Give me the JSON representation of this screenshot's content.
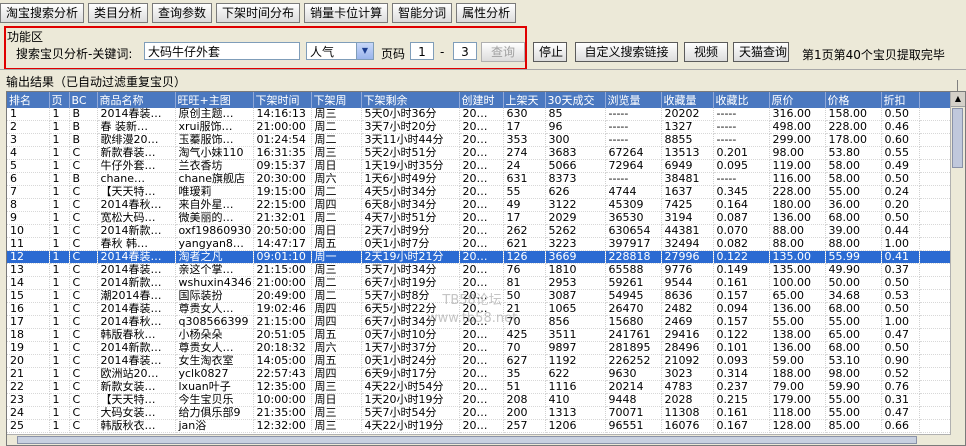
{
  "tabs": [
    "淘宝搜索分析",
    "类目分析",
    "查询参数",
    "下架时间分布",
    "销量卡位计算",
    "智能分词",
    "属性分析"
  ],
  "func_label": "功能区",
  "search": {
    "label": "搜索宝贝分析-关键词:",
    "keyword": "大码牛仔外套",
    "sort_option": "人气",
    "page_label": "页码",
    "page_from": "1",
    "page_dash": "-",
    "page_to": "3",
    "query_button": "查询"
  },
  "buttons": {
    "stop": "停止",
    "custom_link": "自定义搜索链接",
    "video": "视频",
    "tmall_query": "天猫查询"
  },
  "status_text": "第1页第40个宝贝提取完毕",
  "output_label": "输出结果（已自动过滤重复宝贝）",
  "watermark": {
    "line1": "TB58论坛",
    "line2": "www.tb58.net"
  },
  "table": {
    "columns": [
      "排名",
      "页",
      "BC",
      "商品名称",
      "旺旺+主图",
      "下架时间",
      "下架周",
      "下架剩余",
      "创建时",
      "上架天",
      "30天成交",
      "浏览量",
      "收藏量",
      "收藏比",
      "原价",
      "价格",
      "折扣",
      ""
    ],
    "rows": [
      [
        "1",
        "1",
        "B",
        "2014春装…",
        "原创主题…",
        "14:16:13",
        "周三",
        "5天0小时36分",
        "20…",
        "630",
        "85",
        "-----",
        "20202",
        "-----",
        "316.00",
        "158.00",
        "0.50",
        ""
      ],
      [
        "2",
        "1",
        "B",
        "春 装新…",
        "xrui服饰…",
        "21:00:00",
        "周二",
        "3天7小时20分",
        "20…",
        "17",
        "96",
        "-----",
        "1327",
        "-----",
        "498.00",
        "228.00",
        "0.46",
        ""
      ],
      [
        "3",
        "1",
        "B",
        "歌绯漫20…",
        "玉蓁服饰…",
        "01:24:54",
        "周二",
        "3天11小时44分",
        "20…",
        "353",
        "300",
        "-----",
        "8855",
        "-----",
        "299.00",
        "178.00",
        "0.60",
        ""
      ],
      [
        "4",
        "1",
        "C",
        "新款春装…",
        "淘气小妹110",
        "16:31:35",
        "周三",
        "5天2小时51分",
        "20…",
        "274",
        "3683",
        "67264",
        "13513",
        "0.201",
        "98.00",
        "53.80",
        "0.55",
        ""
      ],
      [
        "5",
        "1",
        "C",
        "牛仔外套…",
        "兰衣香坊",
        "09:15:37",
        "周日",
        "1天19小时35分",
        "20…",
        "24",
        "5066",
        "72964",
        "6949",
        "0.095",
        "119.00",
        "58.00",
        "0.49",
        ""
      ],
      [
        "6",
        "1",
        "B",
        "chane…",
        "chane旗舰店",
        "20:30:00",
        "周六",
        "1天6小时49分",
        "20…",
        "631",
        "8373",
        "-----",
        "38481",
        "-----",
        "116.00",
        "58.00",
        "0.50",
        ""
      ],
      [
        "7",
        "1",
        "C",
        "【天天特…",
        "唯瑷莉",
        "19:15:00",
        "周二",
        "4天5小时34分",
        "20…",
        "55",
        "626",
        "4744",
        "1637",
        "0.345",
        "228.00",
        "55.00",
        "0.24",
        ""
      ],
      [
        "8",
        "1",
        "C",
        "2014春秋…",
        "来自外星…",
        "22:15:00",
        "周四",
        "6天8小时34分",
        "20…",
        "49",
        "3122",
        "45309",
        "7425",
        "0.164",
        "180.00",
        "36.00",
        "0.20",
        ""
      ],
      [
        "9",
        "1",
        "C",
        "宽松大码…",
        "微美丽的…",
        "21:32:01",
        "周二",
        "4天7小时51分",
        "20…",
        "17",
        "2029",
        "36530",
        "3194",
        "0.087",
        "136.00",
        "68.00",
        "0.50",
        ""
      ],
      [
        "10",
        "1",
        "C",
        "2014新款…",
        "oxf19860930",
        "20:50:00",
        "周日",
        "2天7小时9分",
        "20…",
        "262",
        "5262",
        "630654",
        "44381",
        "0.070",
        "88.00",
        "39.00",
        "0.44",
        ""
      ],
      [
        "11",
        "1",
        "C",
        "春秋 韩…",
        "yangyan8…",
        "14:47:17",
        "周五",
        "0天1小时7分",
        "20…",
        "621",
        "3223",
        "397917",
        "32494",
        "0.082",
        "88.00",
        "88.00",
        "1.00",
        ""
      ],
      [
        "12",
        "1",
        "C",
        "2014春装…",
        "淘者之凡",
        "09:01:10",
        "周一",
        "2天19小时21分",
        "20…",
        "126",
        "3669",
        "228818",
        "27996",
        "0.122",
        "135.00",
        "55.99",
        "0.41",
        ""
      ],
      [
        "13",
        "1",
        "C",
        "2014春装…",
        "亲这个掌…",
        "21:15:00",
        "周三",
        "5天7小时34分",
        "20…",
        "76",
        "1810",
        "65588",
        "9776",
        "0.149",
        "135.00",
        "49.90",
        "0.37",
        ""
      ],
      [
        "14",
        "1",
        "C",
        "2014新款…",
        "wshuxin4346",
        "21:00:00",
        "周二",
        "6天7小时19分",
        "20…",
        "81",
        "2953",
        "59261",
        "9544",
        "0.161",
        "100.00",
        "50.00",
        "0.50",
        ""
      ],
      [
        "15",
        "1",
        "C",
        "潮2014春…",
        "国际装扮",
        "20:49:00",
        "周二",
        "5天7小时8分",
        "20…",
        "50",
        "3087",
        "54945",
        "8636",
        "0.157",
        "65.00",
        "34.68",
        "0.53",
        ""
      ],
      [
        "16",
        "1",
        "C",
        "2014春装…",
        "尊贵女人…",
        "19:02:46",
        "周四",
        "6天5小时22分",
        "20…",
        "21",
        "1065",
        "26470",
        "2482",
        "0.094",
        "136.00",
        "68.00",
        "0.50",
        ""
      ],
      [
        "17",
        "1",
        "C",
        "2014春秋…",
        "q308566399",
        "21:15:00",
        "周四",
        "6天7小时34分",
        "20…",
        "70",
        "856",
        "15680",
        "2469",
        "0.157",
        "55.00",
        "55.00",
        "1.00",
        ""
      ],
      [
        "18",
        "1",
        "C",
        "韩版春秋…",
        "小杨朵朵",
        "20:51:05",
        "周五",
        "0天7小时10分",
        "20…",
        "425",
        "3511",
        "241761",
        "29416",
        "0.122",
        "138.00",
        "65.00",
        "0.47",
        ""
      ],
      [
        "19",
        "1",
        "C",
        "2014新款…",
        "尊贵女人…",
        "20:18:32",
        "周六",
        "1天7小时37分",
        "20…",
        "70",
        "9897",
        "281895",
        "28496",
        "0.101",
        "136.00",
        "68.00",
        "0.50",
        ""
      ],
      [
        "20",
        "1",
        "C",
        "2014春装…",
        "女生淘衣室",
        "14:05:00",
        "周五",
        "0天1小时24分",
        "20…",
        "627",
        "1192",
        "226252",
        "21092",
        "0.093",
        "59.00",
        "53.10",
        "0.90",
        ""
      ],
      [
        "21",
        "1",
        "C",
        "欧洲站20…",
        "yclk0827",
        "22:57:43",
        "周四",
        "6天9小时17分",
        "20…",
        "35",
        "622",
        "9630",
        "3023",
        "0.314",
        "188.00",
        "98.00",
        "0.52",
        ""
      ],
      [
        "22",
        "1",
        "C",
        "新款女装…",
        "lxuan叶子",
        "12:35:00",
        "周三",
        "4天22小时54分",
        "20…",
        "51",
        "1116",
        "20214",
        "4783",
        "0.237",
        "79.00",
        "59.90",
        "0.76",
        ""
      ],
      [
        "23",
        "1",
        "C",
        "【天天特…",
        "今生宝贝乐",
        "10:00:00",
        "周日",
        "1天20小时19分",
        "20…",
        "208",
        "410",
        "9448",
        "2028",
        "0.215",
        "179.00",
        "55.00",
        "0.31",
        ""
      ],
      [
        "24",
        "1",
        "C",
        "大码女装…",
        "给力俱乐部9",
        "21:35:00",
        "周三",
        "5天7小时54分",
        "20…",
        "200",
        "1313",
        "70071",
        "11308",
        "0.161",
        "118.00",
        "55.00",
        "0.47",
        ""
      ],
      [
        "25",
        "1",
        "C",
        "韩版秋衣…",
        "jan浴",
        "12:32:00",
        "周三",
        "4天22小时19分",
        "20…",
        "257",
        "1206",
        "96551",
        "16076",
        "0.167",
        "128.00",
        "85.00",
        "0.66",
        ""
      ]
    ],
    "selected_row_index": 11
  }
}
